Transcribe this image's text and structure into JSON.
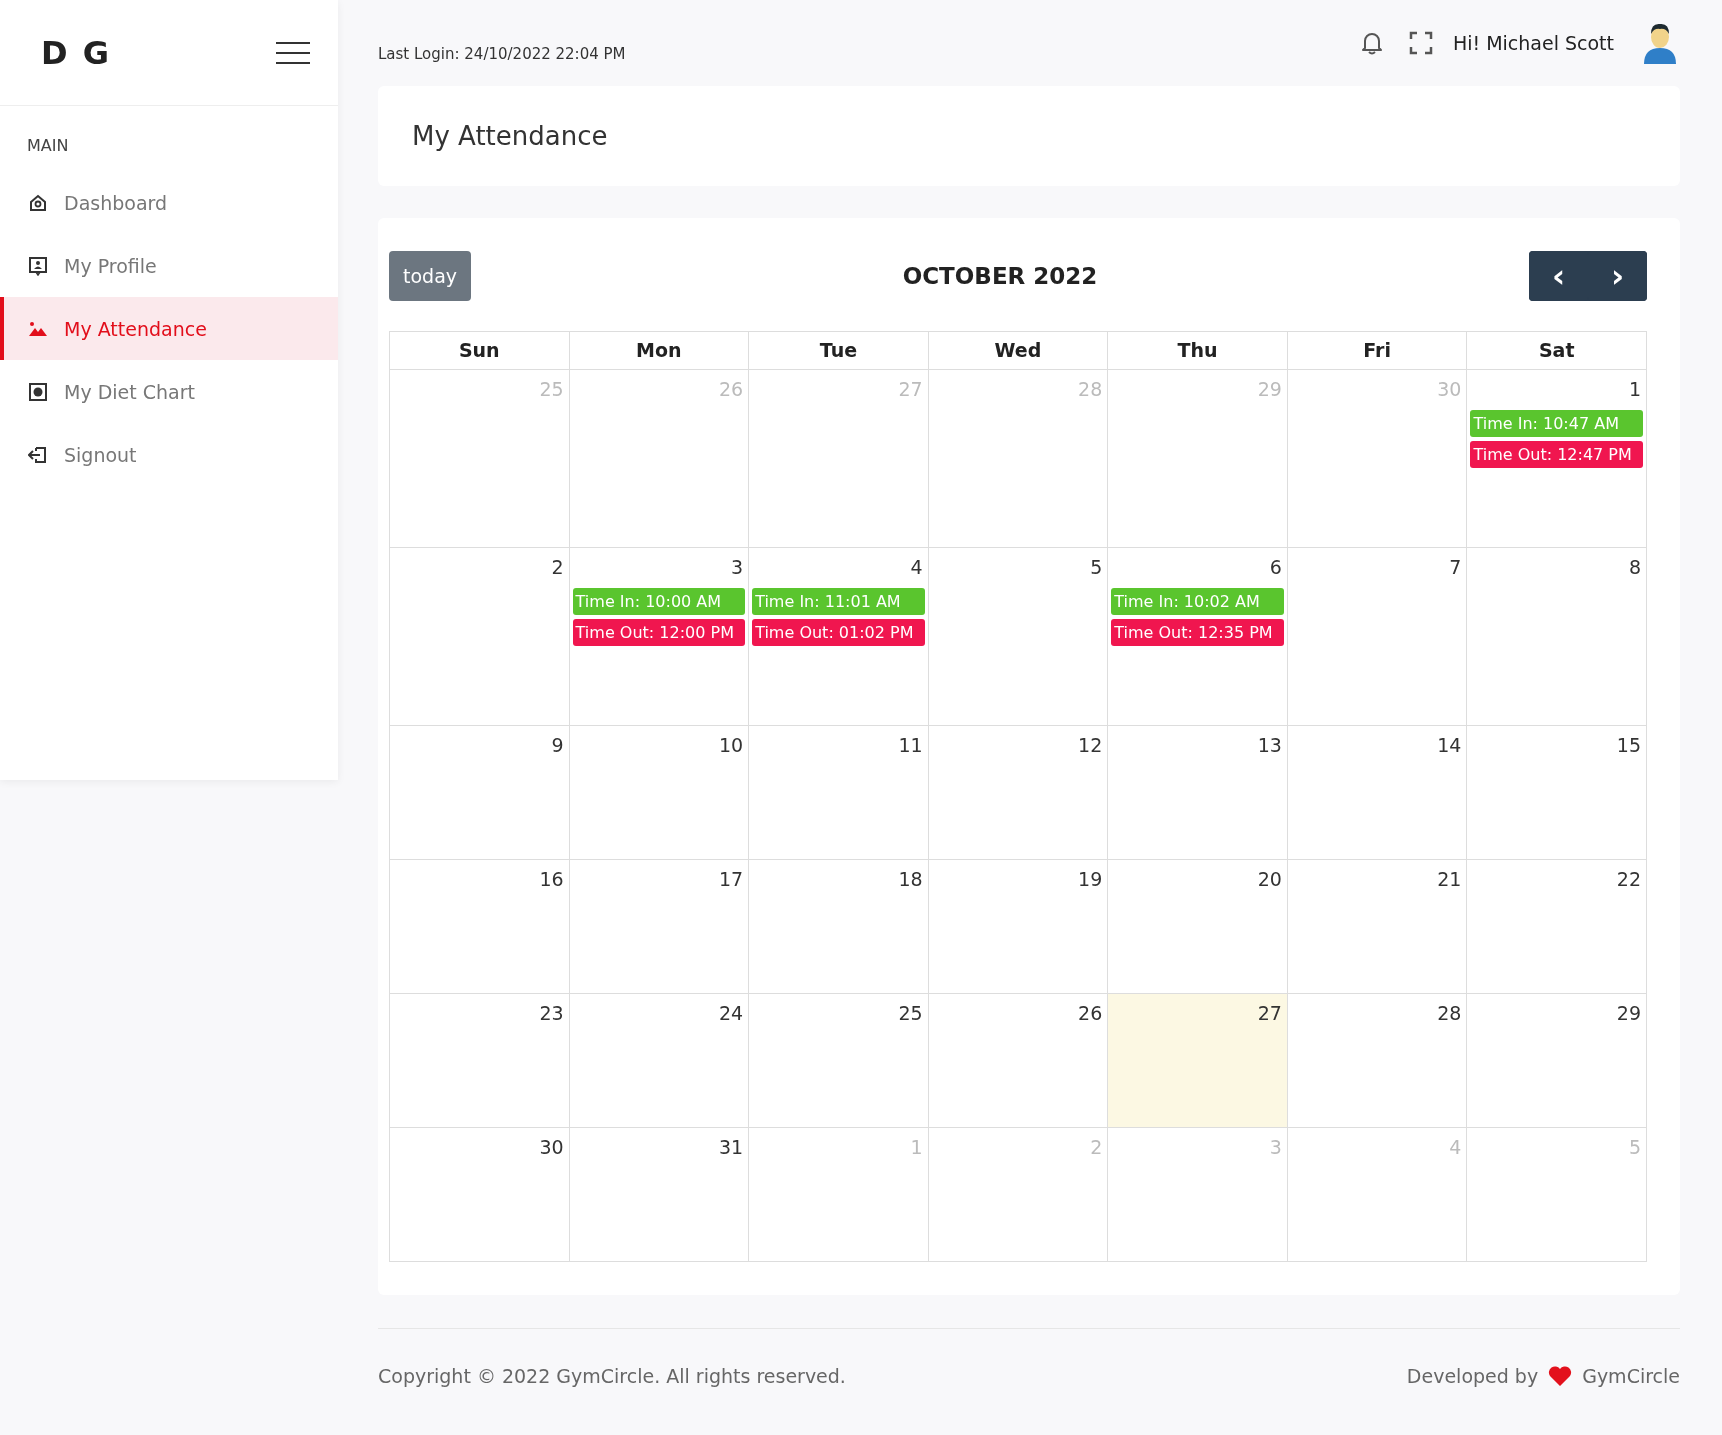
{
  "brand": "D G",
  "last_login": "Last Login: 24/10/2022 22:04 PM",
  "user_greeting": "Hi! Michael Scott",
  "sidebar": {
    "section": "MAIN",
    "items": [
      {
        "label": "Dashboard",
        "kind": "home",
        "selected": false
      },
      {
        "label": "My Profile",
        "kind": "profile",
        "selected": false
      },
      {
        "label": "My Attendance",
        "kind": "attendance",
        "selected": true
      },
      {
        "label": "My Diet Chart",
        "kind": "diet",
        "selected": false
      },
      {
        "label": "Signout",
        "kind": "signout",
        "selected": false
      }
    ]
  },
  "page_title": "My Attendance",
  "calendar": {
    "today_button": "today",
    "title": "OCTOBER 2022",
    "prev": "‹",
    "next": "›",
    "weekdays": [
      "Sun",
      "Mon",
      "Tue",
      "Wed",
      "Thu",
      "Fri",
      "Sat"
    ],
    "weeks": [
      [
        {
          "day": "25",
          "other_month": true,
          "today": false
        },
        {
          "day": "26",
          "other_month": true,
          "today": false
        },
        {
          "day": "27",
          "other_month": true,
          "today": false
        },
        {
          "day": "28",
          "other_month": true,
          "today": false
        },
        {
          "day": "29",
          "other_month": true,
          "today": false
        },
        {
          "day": "30",
          "other_month": true,
          "today": false
        },
        {
          "day": "1",
          "other_month": false,
          "today": false,
          "events": [
            {
              "kind": "in",
              "text": "Time In: 10:47 AM"
            },
            {
              "kind": "out",
              "text": "Time Out: 12:47 PM"
            }
          ]
        }
      ],
      [
        {
          "day": "2",
          "other_month": false,
          "today": false
        },
        {
          "day": "3",
          "other_month": false,
          "today": false,
          "events": [
            {
              "kind": "in",
              "text": "Time In: 10:00 AM"
            },
            {
              "kind": "out",
              "text": "Time Out: 12:00 PM"
            }
          ]
        },
        {
          "day": "4",
          "other_month": false,
          "today": false,
          "events": [
            {
              "kind": "in",
              "text": "Time In: 11:01 AM"
            },
            {
              "kind": "out",
              "text": "Time Out: 01:02 PM"
            }
          ]
        },
        {
          "day": "5",
          "other_month": false,
          "today": false
        },
        {
          "day": "6",
          "other_month": false,
          "today": false,
          "events": [
            {
              "kind": "in",
              "text": "Time In: 10:02 AM"
            },
            {
              "kind": "out",
              "text": "Time Out: 12:35 PM"
            }
          ]
        },
        {
          "day": "7",
          "other_month": false,
          "today": false
        },
        {
          "day": "8",
          "other_month": false,
          "today": false
        }
      ],
      [
        {
          "day": "9",
          "other_month": false,
          "today": false
        },
        {
          "day": "10",
          "other_month": false,
          "today": false
        },
        {
          "day": "11",
          "other_month": false,
          "today": false
        },
        {
          "day": "12",
          "other_month": false,
          "today": false
        },
        {
          "day": "13",
          "other_month": false,
          "today": false
        },
        {
          "day": "14",
          "other_month": false,
          "today": false
        },
        {
          "day": "15",
          "other_month": false,
          "today": false
        }
      ],
      [
        {
          "day": "16",
          "other_month": false,
          "today": false
        },
        {
          "day": "17",
          "other_month": false,
          "today": false
        },
        {
          "day": "18",
          "other_month": false,
          "today": false
        },
        {
          "day": "19",
          "other_month": false,
          "today": false
        },
        {
          "day": "20",
          "other_month": false,
          "today": false
        },
        {
          "day": "21",
          "other_month": false,
          "today": false
        },
        {
          "day": "22",
          "other_month": false,
          "today": false
        }
      ],
      [
        {
          "day": "23",
          "other_month": false,
          "today": false
        },
        {
          "day": "24",
          "other_month": false,
          "today": false
        },
        {
          "day": "25",
          "other_month": false,
          "today": false
        },
        {
          "day": "26",
          "other_month": false,
          "today": false
        },
        {
          "day": "27",
          "other_month": false,
          "today": true
        },
        {
          "day": "28",
          "other_month": false,
          "today": false
        },
        {
          "day": "29",
          "other_month": false,
          "today": false
        }
      ],
      [
        {
          "day": "30",
          "other_month": false,
          "today": false
        },
        {
          "day": "31",
          "other_month": false,
          "today": false
        },
        {
          "day": "1",
          "other_month": true,
          "today": false
        },
        {
          "day": "2",
          "other_month": true,
          "today": false
        },
        {
          "day": "3",
          "other_month": true,
          "today": false
        },
        {
          "day": "4",
          "other_month": true,
          "today": false
        },
        {
          "day": "5",
          "other_month": true,
          "today": false
        }
      ]
    ]
  },
  "footer": {
    "copyright": "Copyright © 2022 GymCircle. All rights reserved.",
    "developed_by": "Developed by",
    "developer": "GymCircle"
  }
}
